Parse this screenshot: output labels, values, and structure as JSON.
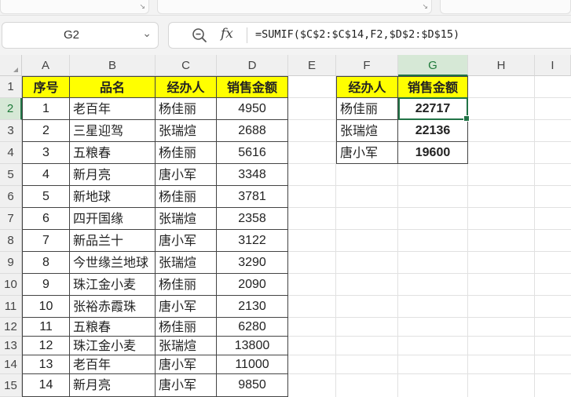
{
  "formula_bar": {
    "name_box": "G2",
    "fx_label": "fx",
    "formula": "=SUMIF($C$2:$C$14,F2,$D$2:$D$15)"
  },
  "columns": [
    "A",
    "B",
    "C",
    "D",
    "E",
    "F",
    "G",
    "H",
    "I"
  ],
  "rows": [
    "1",
    "2",
    "3",
    "4",
    "5",
    "6",
    "7",
    "8",
    "9",
    "10",
    "11",
    "12",
    "13",
    "14",
    "15"
  ],
  "table": {
    "headers": [
      "序号",
      "品名",
      "经办人",
      "销售金额"
    ],
    "rows": [
      [
        "1",
        "老百年",
        "杨佳丽",
        "4950"
      ],
      [
        "2",
        "三星迎驾",
        "张瑞煊",
        "2688"
      ],
      [
        "3",
        "五粮春",
        "杨佳丽",
        "5616"
      ],
      [
        "4",
        "新月亮",
        "唐小军",
        "3348"
      ],
      [
        "5",
        "新地球",
        "杨佳丽",
        "3781"
      ],
      [
        "6",
        "四开国缘",
        "张瑞煊",
        "2358"
      ],
      [
        "7",
        "新品兰十",
        "唐小军",
        "3122"
      ],
      [
        "8",
        "今世缘兰地球",
        "张瑞煊",
        "3290"
      ],
      [
        "9",
        "珠江金小麦",
        "杨佳丽",
        "2090"
      ],
      [
        "10",
        "张裕赤霞珠",
        "唐小军",
        "2130"
      ],
      [
        "11",
        "五粮春",
        "杨佳丽",
        "6280"
      ],
      [
        "12",
        "珠江金小麦",
        "张瑞煊",
        "13800"
      ],
      [
        "13",
        "老百年",
        "唐小军",
        "11000"
      ],
      [
        "14",
        "新月亮",
        "唐小军",
        "9850"
      ]
    ]
  },
  "summary": {
    "headers": [
      "经办人",
      "销售金额"
    ],
    "rows": [
      [
        "杨佳丽",
        "22717"
      ],
      [
        "张瑞煊",
        "22136"
      ],
      [
        "唐小军",
        "19600"
      ]
    ]
  },
  "colors": {
    "header_fill": "#ffff00",
    "selection": "#217346"
  }
}
